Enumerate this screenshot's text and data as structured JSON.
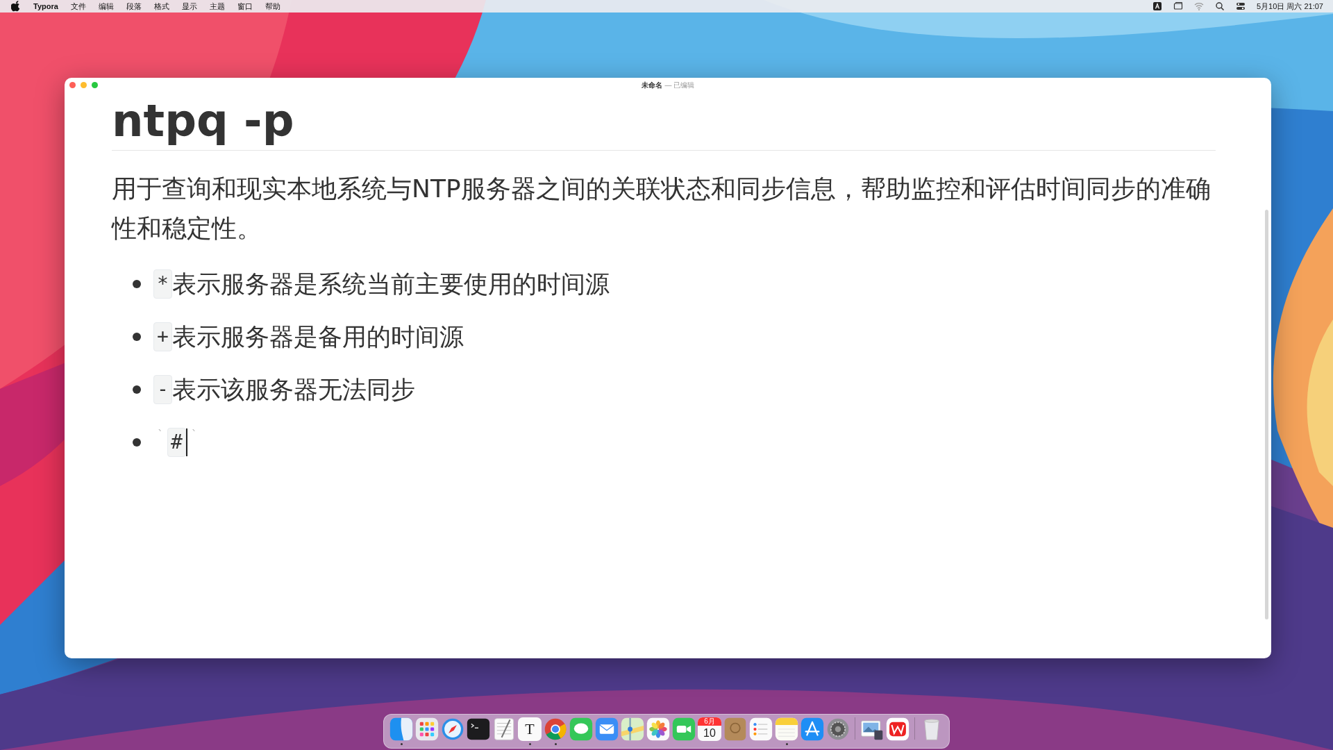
{
  "menu_bar": {
    "app_name": "Typora",
    "menus": [
      "文件",
      "编辑",
      "段落",
      "格式",
      "显示",
      "主题",
      "窗口",
      "帮助"
    ],
    "status_icons": [
      {
        "kind": "input"
      },
      {
        "kind": "display"
      },
      {
        "kind": "wifi"
      },
      {
        "kind": "search"
      },
      {
        "kind": "control"
      }
    ],
    "clock": "5月10日 周六 21:07"
  },
  "window": {
    "title": "未命名",
    "edited": "— 已编辑"
  },
  "document": {
    "heading": "ntpq -p",
    "paragraph": "用于查询和现实本地系统与NTP服务器之间的关联状态和同步信息，帮助监控和评估时间同步的准确性和稳定性。",
    "list": [
      {
        "kind": "item",
        "code": "*",
        "text": "表示服务器是系统当前主要使用的时间源"
      },
      {
        "kind": "item",
        "code": "+",
        "text": "表示服务器是备用的时间源"
      },
      {
        "kind": "item",
        "code": "-",
        "text": "表示该服务器无法同步"
      },
      {
        "kind": "editing",
        "open_mark": "`",
        "code": "#",
        "close_mark": "`"
      }
    ]
  },
  "dock": {
    "items": [
      {
        "kind": "finder",
        "running": true
      },
      {
        "kind": "launchpad",
        "running": false
      },
      {
        "kind": "safari",
        "running": false
      },
      {
        "kind": "terminal",
        "running": false
      },
      {
        "kind": "textedit",
        "running": false
      },
      {
        "kind": "letter",
        "letter": "T",
        "running": true
      },
      {
        "kind": "chrome",
        "running": true
      },
      {
        "kind": "messages",
        "running": false
      },
      {
        "kind": "mail",
        "running": false
      },
      {
        "kind": "maps",
        "running": false
      },
      {
        "kind": "photos",
        "running": false
      },
      {
        "kind": "facetime",
        "running": false
      },
      {
        "kind": "calendar",
        "month": "6月",
        "day": "10",
        "running": false
      },
      {
        "kind": "contacts",
        "running": false
      },
      {
        "kind": "reminders",
        "running": false
      },
      {
        "kind": "notes",
        "running": true
      },
      {
        "kind": "appstore",
        "running": false
      },
      {
        "kind": "settings",
        "running": false
      },
      {
        "kind": "separator"
      },
      {
        "kind": "preview",
        "running": false
      },
      {
        "kind": "wps",
        "running": false
      },
      {
        "kind": "separator"
      },
      {
        "kind": "trash",
        "running": false
      }
    ]
  }
}
